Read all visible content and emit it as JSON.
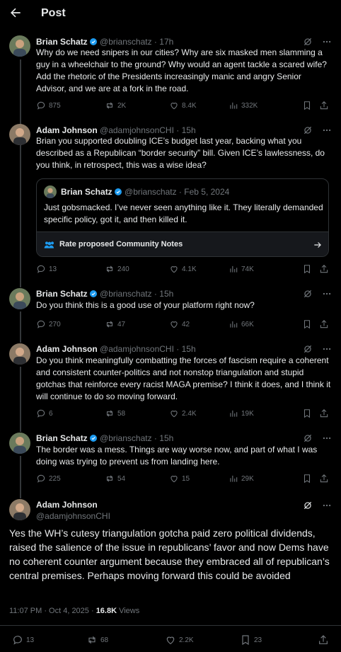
{
  "header": {
    "title": "Post"
  },
  "colors": {
    "background": "#000000",
    "text": "#e7e9ea",
    "muted": "#71767b",
    "border": "#2f3336",
    "verified": "#1d9bf0"
  },
  "icons": {
    "back": "back-arrow-icon",
    "grok": "grok-icon",
    "more": "more-dots-icon",
    "reply": "reply-icon",
    "repost": "repost-icon",
    "like": "like-icon",
    "views": "views-icon",
    "bookmark": "bookmark-icon",
    "share": "share-icon"
  },
  "tweets": [
    {
      "name": "Brian Schatz",
      "handle": "@brianschatz",
      "dot": "·",
      "time": "17h",
      "text": "Why do we need snipers in our cities? Why are six masked men slamming a guy in a wheelchair to the ground? Why would an agent tackle a scared wife? Add the rhetoric of the Presidents increasingly manic and angry Senior Advisor, and we are at a fork in the road.",
      "replies": "875",
      "reposts": "2K",
      "likes": "8.4K",
      "views": "332K"
    },
    {
      "name": "Adam Johnson",
      "handle": "@adamjohnsonCHI",
      "dot": "·",
      "time": "15h",
      "text": "Brian you supported doubling ICE’s budget last year, backing what you described as a Republican “border security” bill. Given ICE’s lawlessness, do you think, in retrospect, this was a wise idea?",
      "quote": {
        "name": "Brian Schatz",
        "handle": "@brianschatz",
        "dot": "·",
        "time": "Feb 5, 2024",
        "text": "Just gobsmacked. I’ve never seen anything like it. They literally demanded specific policy, got it, and then killed it.",
        "community_notes": "Rate proposed Community Notes"
      },
      "replies": "13",
      "reposts": "240",
      "likes": "4.1K",
      "views": "74K"
    },
    {
      "name": "Brian Schatz",
      "handle": "@brianschatz",
      "dot": "·",
      "time": "15h",
      "text": "Do you think this is a good use of your platform right now?",
      "replies": "270",
      "reposts": "47",
      "likes": "42",
      "views": "66K"
    },
    {
      "name": "Adam Johnson",
      "handle": "@adamjohnsonCHI",
      "dot": "·",
      "time": "15h",
      "text": "Do you think meaningfully combatting the forces of fascism require a coherent and consistent counter-politics and not nonstop triangulation and stupid gotchas that reinforce every racist MAGA premise? I think it does, and I think it will continue to do so moving forward.",
      "replies": "6",
      "reposts": "58",
      "likes": "2.4K",
      "views": "19K"
    },
    {
      "name": "Brian Schatz",
      "handle": "@brianschatz",
      "dot": "·",
      "time": "15h",
      "text": "The border was a mess. Things are way worse now, and part of what I was doing was trying to prevent us from landing here.",
      "replies": "225",
      "reposts": "54",
      "likes": "15",
      "views": "29K"
    }
  ],
  "main": {
    "name": "Adam Johnson",
    "handle": "@adamjohnsonCHI",
    "text": "Yes the WH’s cutesy triangulation gotcha paid zero political dividends, raised the salience of the issue in republicans’ favor and now Dems have no coherent counter argument because they embraced all of republican’s central premises. Perhaps moving forward this could be avoided",
    "timestamp": "11:07 PM · Oct 4, 2025 · ",
    "views_count": "16.8K",
    "views_label": " Views",
    "replies": "13",
    "reposts": "68",
    "likes": "2.2K",
    "bookmarks": "23"
  }
}
